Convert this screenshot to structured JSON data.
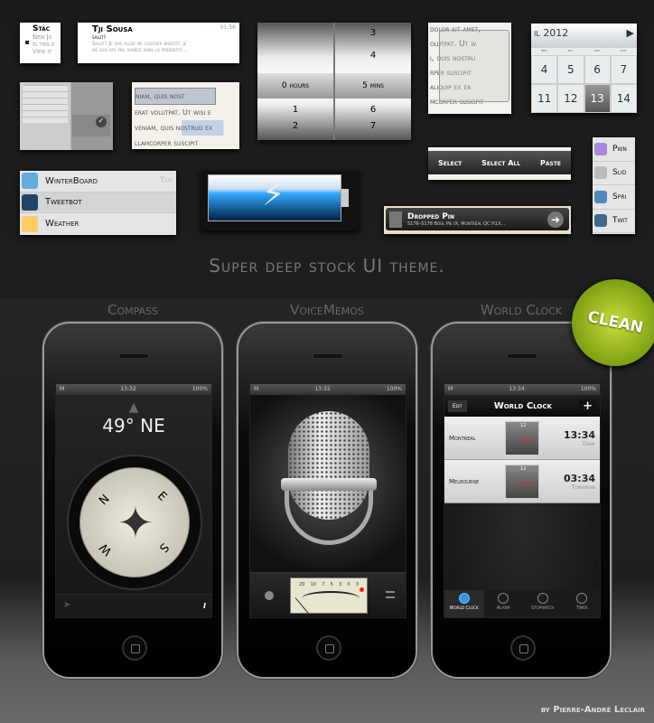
{
  "title": "Super deep stock UI theme.",
  "credit": "by Pierre-André Leclair",
  "badge": "CLEAN",
  "mail": {
    "sender": "Stac",
    "subject": "New Jo",
    "line1": "Is this e",
    "line2": "View it"
  },
  "message": {
    "sender": "Tji Sousa",
    "time": "01:56",
    "subject": "salut!",
    "body1": "Salut! Je vais aller me coucher bientôt, je",
    "body2": "me suis pas mal avancé dans la présentat..."
  },
  "timer": {
    "hours_col": [
      "",
      "1",
      "2"
    ],
    "mins_col": [
      "3",
      "4",
      "6",
      "7"
    ],
    "hours_label": "0 hours",
    "mins_label": "5 mins"
  },
  "loupe": {
    "lines": [
      "dolor sit amet,",
      "olutpat. Ut w",
      "i, quis nostru",
      "rper suscipit",
      "aliquip ex ea",
      "mcorper suscipit"
    ]
  },
  "calendar": {
    "month": "il 2012",
    "days": [
      "mer.",
      "jeu.",
      "ven.",
      "sam."
    ],
    "row1": [
      "4",
      "5",
      "6",
      "7"
    ],
    "row2": [
      "11",
      "12",
      "13",
      "14"
    ],
    "selected": "13"
  },
  "selection": {
    "line1": "niam, quis nost",
    "line2": "erat volutpat. Ut wisi e",
    "line3": "veniam, quis nostrud ex",
    "line4": "llamcorper suscipit"
  },
  "applist": {
    "items": [
      {
        "label": "WinterBoard",
        "extra": "Top"
      },
      {
        "label": "Tweetbot"
      },
      {
        "label": "Weather"
      }
    ]
  },
  "editmenu": {
    "select": "Select",
    "select_all": "Select All",
    "paste": "Paste"
  },
  "pin": {
    "title": "Dropped Pin",
    "address": "5176–5178 Boul Pie IX, Montréal QC H1X..."
  },
  "settings": {
    "items": [
      "Pwn",
      "Slid",
      "Spri",
      "Twit"
    ]
  },
  "phones": {
    "compass": {
      "label": "Compass",
      "time": "13:32",
      "battery": "100%",
      "carrier": "M",
      "heading": "49° NE",
      "dirs": [
        "N",
        "E",
        "S",
        "W"
      ]
    },
    "voicememos": {
      "label": "VoiceMemos",
      "time": "13:32",
      "battery": "100%",
      "carrier": "M",
      "scale": [
        "20",
        "10",
        "7",
        "5",
        "3",
        "0",
        "3"
      ]
    },
    "worldclock": {
      "label": "World Clock",
      "time": "13:34",
      "battery": "100%",
      "carrier": "M",
      "edit": "Edit",
      "title": "World Clock",
      "add": "+",
      "cities": [
        {
          "name": "Montreal",
          "time": "13:34",
          "day": "Today"
        },
        {
          "name": "Melbourne",
          "time": "03:34",
          "day": "Tomorrow"
        }
      ],
      "tabs": [
        "World Clock",
        "Alarm",
        "Stopwatch",
        "Timer"
      ]
    }
  },
  "colors": {
    "accent": "#8fb21a",
    "selection": "#2255dd"
  }
}
